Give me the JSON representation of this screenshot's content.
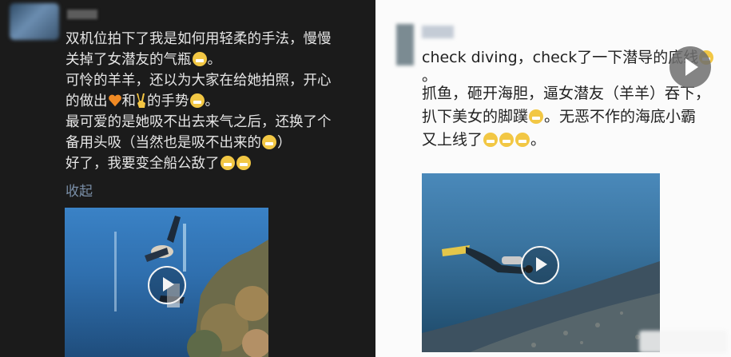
{
  "left_post": {
    "lines": [
      "双机位拍下了我是如何用轻柔的手法，慢慢",
      "关掉了女潜友的气瓶",
      "可怜的羊羊，还以为大家在给她拍照，开心",
      "的做出",
      "和",
      "的手势",
      "最可爱的是她吸不出去来气之后，还换了个",
      "备用头吸（当然也是吸不出来的",
      "好了，我要变全船公敌了"
    ],
    "period": "。",
    "close_paren": "）",
    "collapse_label": "收起"
  },
  "right_post": {
    "lines": [
      "check diving，check了一下潜导的底线",
      "。",
      "抓鱼，砸开海胆，逼女潜友（羊羊）吞下，",
      "扒下美女的脚蹼",
      "。无恶不作的海底小霸",
      "又上线了",
      "。"
    ]
  },
  "icons": {
    "emoji": "grinning-face-icon",
    "heart": "orange-heart-icon",
    "hand": "victory-hand-icon",
    "play": "play-icon"
  },
  "colors": {
    "left_bg": "#1b1b1b",
    "left_text": "#e6e6e6",
    "link": "#7a8fa8",
    "right_bg": "#fbfbfb",
    "right_text": "#222222",
    "emoji": "#f2c744"
  }
}
